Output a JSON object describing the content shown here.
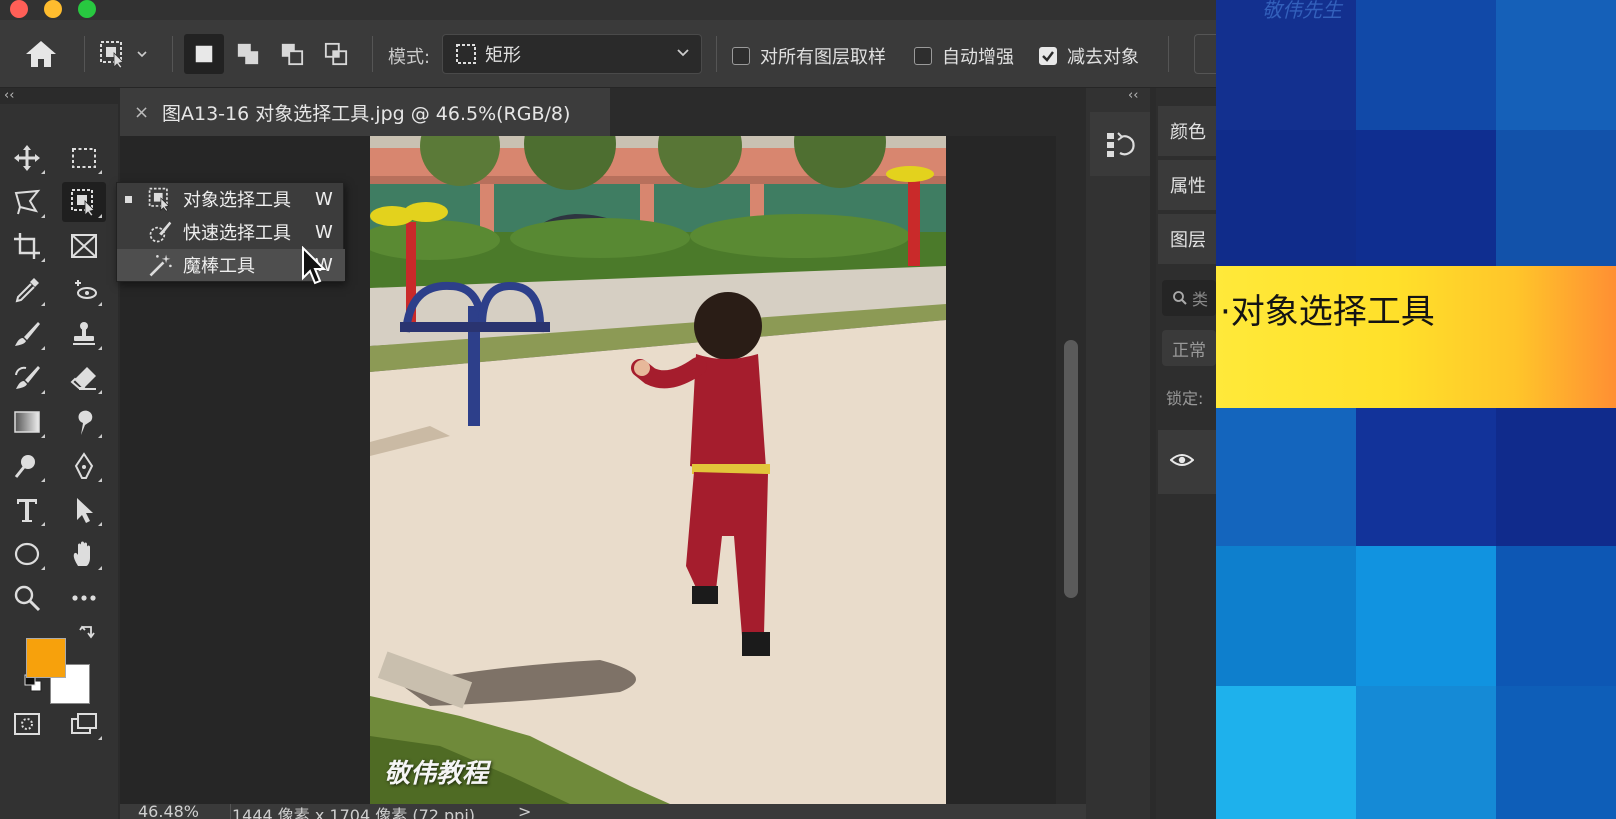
{
  "options_bar": {
    "mode_label": "模式:",
    "mode_value": "矩形",
    "checkbox_sample_all": {
      "label": "对所有图层取样",
      "checked": false
    },
    "checkbox_auto_enhance": {
      "label": "自动增强",
      "checked": false
    },
    "checkbox_subtract_object": {
      "label": "减去对象",
      "checked": true
    },
    "selection_modes": [
      "new-selection",
      "add-to-selection",
      "subtract-from-selection",
      "intersect-with-selection"
    ],
    "active_selection_mode": "new-selection"
  },
  "document": {
    "tab_close": "×",
    "tab_title": "图A13-16 对象选择工具.jpg @ 46.5%(RGB/8)",
    "watermark": "敬伟教程"
  },
  "status_bar": {
    "zoom": "46.48%",
    "dimensions": "1444 像素 x 1704 像素 (72 ppi)",
    "arrow": ">"
  },
  "flyout_menu": {
    "items": [
      {
        "label": "对象选择工具",
        "shortcut": "W",
        "icon": "object-selection-icon",
        "current": true
      },
      {
        "label": "快速选择工具",
        "shortcut": "W",
        "icon": "quick-selection-icon",
        "current": false
      },
      {
        "label": "魔棒工具",
        "shortcut": "W",
        "icon": "magic-wand-icon",
        "current": false
      }
    ]
  },
  "toolbar": {
    "collapse_glyph": "‹‹",
    "foreground_color": "#f7a10c",
    "background_color": "#ffffff"
  },
  "right_panels": {
    "collapse_glyph": "‹‹",
    "tabs": [
      "颜色",
      "属性",
      "图层"
    ],
    "layer_search_placeholder": "类",
    "blend_mode": "正常",
    "lock_label": "锁定:"
  },
  "overlay": {
    "banner_text": "·对象选择工具",
    "top_watermark": "敬伟先生"
  }
}
